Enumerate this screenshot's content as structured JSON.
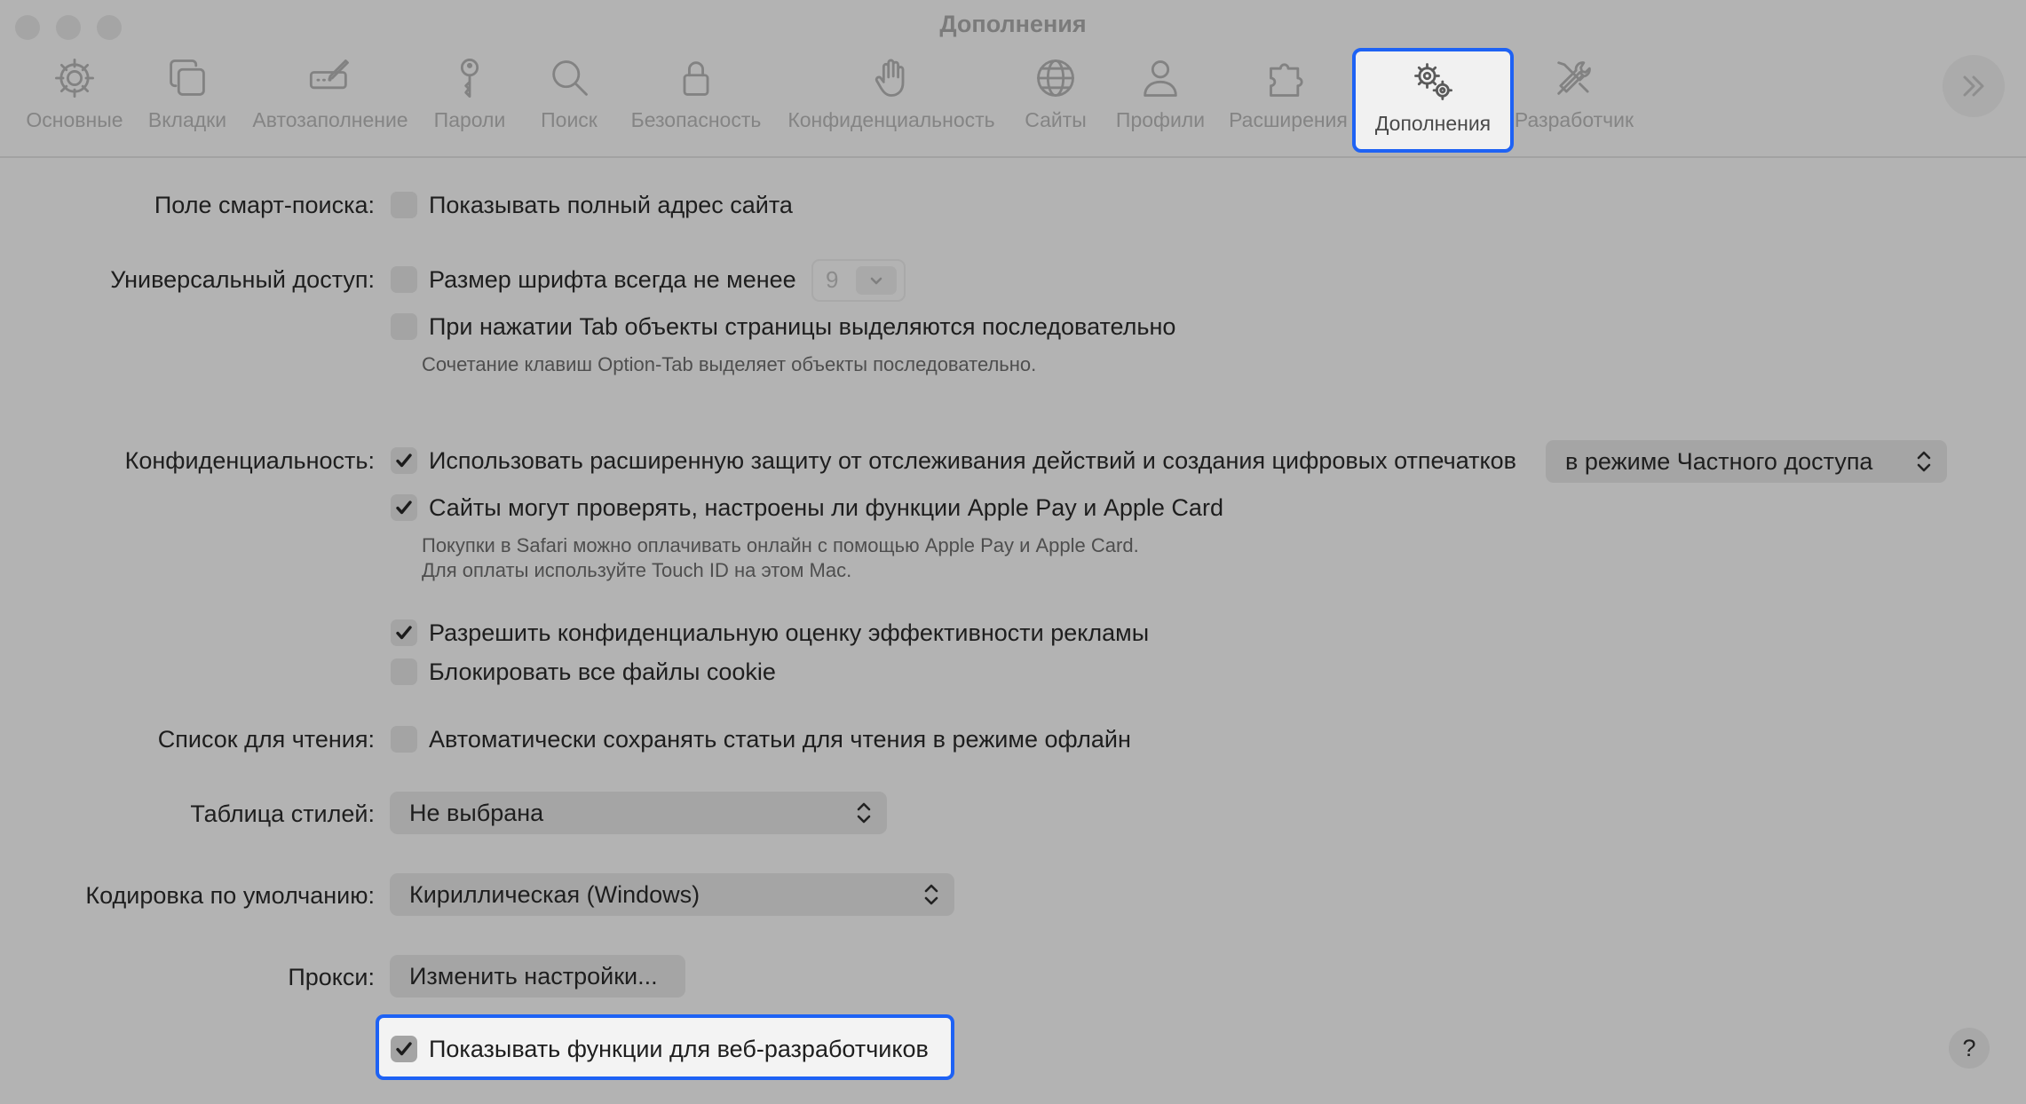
{
  "window": {
    "title": "Дополнения"
  },
  "toolbar": {
    "tabs": [
      {
        "label": "Основные"
      },
      {
        "label": "Вкладки"
      },
      {
        "label": "Автозаполнение"
      },
      {
        "label": "Пароли"
      },
      {
        "label": "Поиск"
      },
      {
        "label": "Безопасность"
      },
      {
        "label": "Конфиденциальность"
      },
      {
        "label": "Сайты"
      },
      {
        "label": "Профили"
      },
      {
        "label": "Расширения"
      },
      {
        "label": "Дополнения",
        "selected": true
      },
      {
        "label": "Разработчик"
      }
    ]
  },
  "settings": {
    "smart_search": {
      "label": "Поле смарт-поиска:",
      "full_address": {
        "text": "Показывать полный адрес сайта",
        "checked": false
      }
    },
    "accessibility": {
      "label": "Универсальный доступ:",
      "min_font": {
        "text": "Размер шрифта всегда не менее",
        "checked": false,
        "value": "9"
      },
      "tab_highlight": {
        "text": "При нажатии Tab объекты страницы выделяются последовательно",
        "checked": false
      },
      "hint": "Сочетание клавиш Option-Tab выделяет объекты последовательно."
    },
    "privacy": {
      "label": "Конфиденциальность:",
      "advanced_protection": {
        "text": "Использовать расширенную защиту от отслеживания действий и создания цифровых отпечатков",
        "checked": true,
        "mode": "в режиме Частного доступа"
      },
      "apple_pay": {
        "text": "Сайты могут проверять, настроены ли функции Apple Pay и Apple Card",
        "checked": true
      },
      "apple_pay_hint_1": "Покупки в Safari можно оплачивать онлайн с помощью Apple Pay и Apple Card.",
      "apple_pay_hint_2": "Для оплаты используйте Touch ID на этом Mac.",
      "ad_measurement": {
        "text": "Разрешить конфиденциальную оценку эффективности рекламы",
        "checked": true
      },
      "block_cookies": {
        "text": "Блокировать все файлы cookie",
        "checked": false
      }
    },
    "reading_list": {
      "label": "Список для чтения:",
      "offline": {
        "text": "Автоматически сохранять статьи для чтения в режиме офлайн",
        "checked": false
      }
    },
    "stylesheet": {
      "label": "Таблица стилей:",
      "value": "Не выбрана"
    },
    "encoding": {
      "label": "Кодировка по умолчанию:",
      "value": "Кириллическая (Windows)"
    },
    "proxies": {
      "label": "Прокси:",
      "button": "Изменить настройки..."
    },
    "developer": {
      "text": "Показывать функции для веб-разработчиков",
      "checked": true
    }
  },
  "help": {
    "label": "?"
  },
  "colors": {
    "accent": "#1e62f4",
    "background": "#b3b3b3"
  }
}
